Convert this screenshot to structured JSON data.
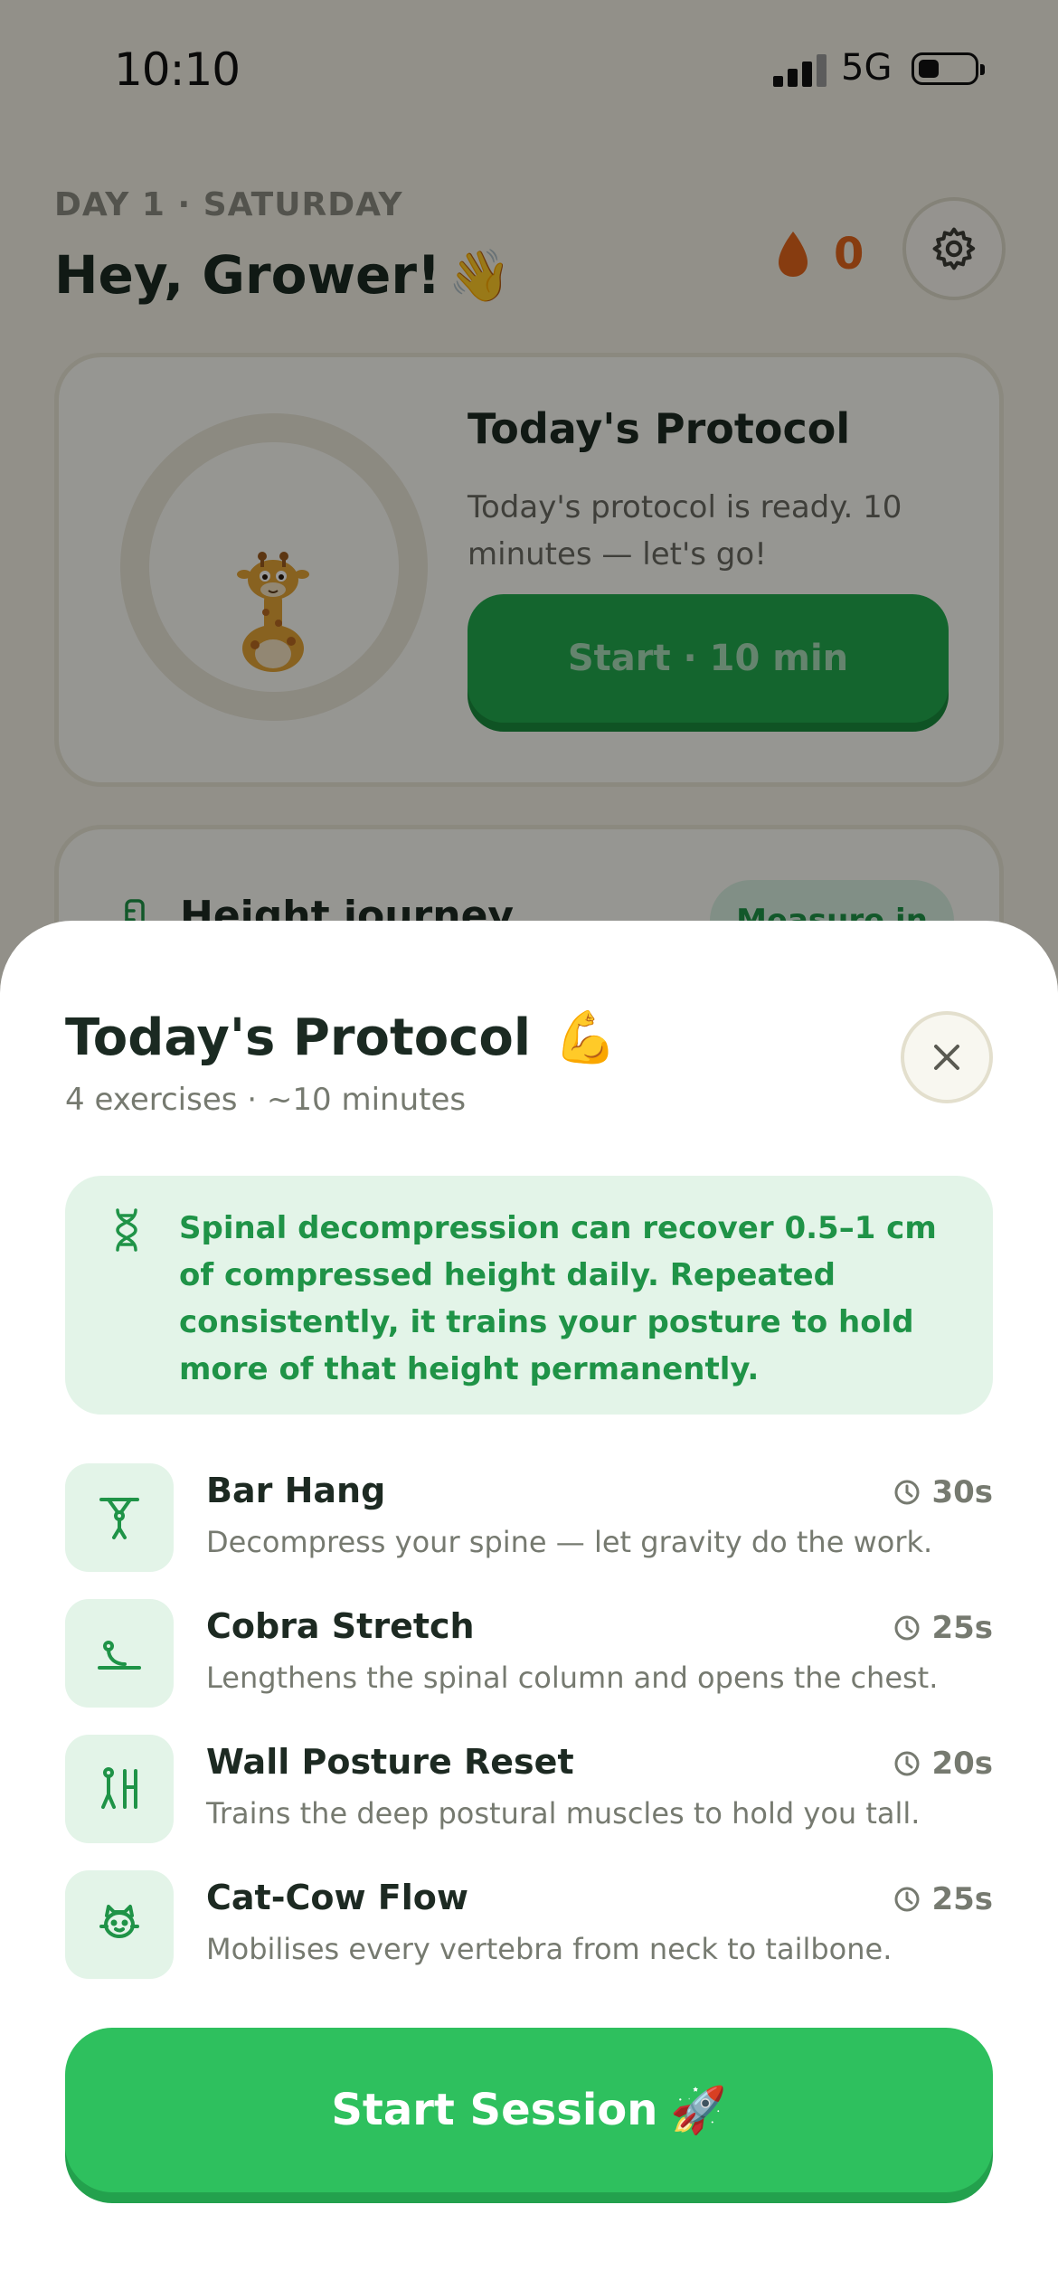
{
  "status_bar": {
    "time": "10:10",
    "network": "5G"
  },
  "header": {
    "day_label": "DAY 1 · SATURDAY",
    "greeting": "Hey, Grower!",
    "greeting_emoji": "👋",
    "streak_count": "0",
    "streak_icon": "flame-drop-icon",
    "settings_icon": "gear-icon"
  },
  "protocol_card": {
    "title": "Today's Protocol",
    "description": "Today's protocol is ready. 10 minutes — let's go!",
    "start_label": "Start · 10 min",
    "mascot": "giraffe-mascot",
    "progress_fraction": 0
  },
  "journey_card": {
    "title": "Height journey",
    "measure_label": "Measure in"
  },
  "sheet": {
    "title": "Today's Protocol",
    "title_emoji": "💪",
    "subtitle": "4 exercises · ~10 minutes",
    "close_icon": "close-icon",
    "tip": {
      "icon": "dna-icon",
      "text": "Spinal decompression can recover 0.5–1 cm of compressed height daily. Repeated consistently, it trains your posture to hold more of that height permanently."
    },
    "exercises": [
      {
        "name": "Bar Hang",
        "description": "Decompress your spine — let gravity do the work.",
        "duration": "30s",
        "icon": "bar-hang-icon"
      },
      {
        "name": "Cobra Stretch",
        "description": "Lengthens the spinal column and opens the chest.",
        "duration": "25s",
        "icon": "cobra-stretch-icon"
      },
      {
        "name": "Wall Posture Reset",
        "description": "Trains the deep postural muscles to hold you tall.",
        "duration": "20s",
        "icon": "wall-posture-icon"
      },
      {
        "name": "Cat-Cow Flow",
        "description": "Mobilises every vertebra from neck to tailbone.",
        "duration": "25s",
        "icon": "cat-cow-icon"
      }
    ],
    "start_label": "Start Session",
    "start_emoji": "🚀"
  },
  "colors": {
    "primary_green": "#2ec05e",
    "dark_green": "#1f9347",
    "tip_background": "#e3f4e8",
    "streak_orange": "#e1641c",
    "text_dark": "#1d2a22",
    "text_muted": "#767a70"
  }
}
